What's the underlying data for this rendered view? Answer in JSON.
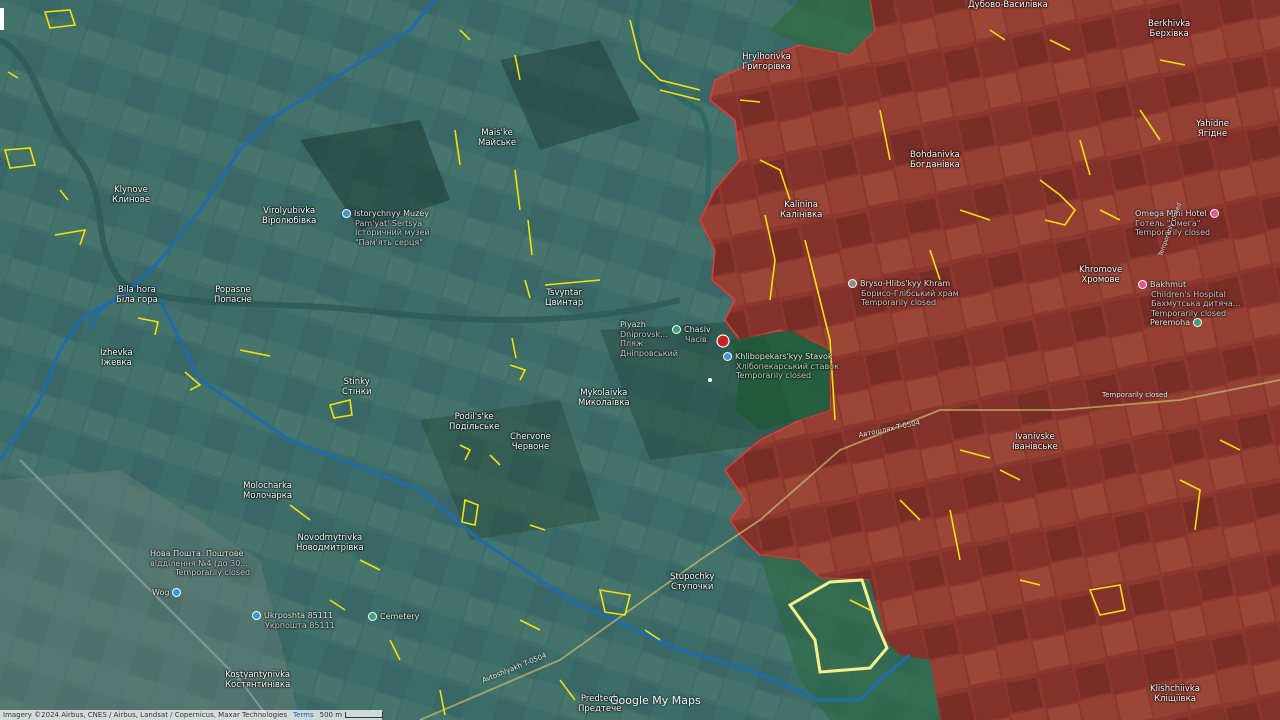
{
  "places": [
    {
      "id": "hryhorivka",
      "name": "Hrylhorivka",
      "local": "Григорівка"
    },
    {
      "id": "klynove",
      "name": "Klynove",
      "local": "Клинове"
    },
    {
      "id": "maiske",
      "name": "Mais'ke",
      "local": "Майське"
    },
    {
      "id": "virolyubivka",
      "name": "Virolyubivka",
      "local": "Віролюбівка"
    },
    {
      "id": "kalinina",
      "name": "Kalinina",
      "local": "Калінівка"
    },
    {
      "id": "bohdanivka",
      "name": "Bohdanivka",
      "local": "Богданівка"
    },
    {
      "id": "berkhivka",
      "name": "Berkhivka",
      "local": "Берхівка"
    },
    {
      "id": "yahidne",
      "name": "Yahidne",
      "local": "Ягідне"
    },
    {
      "id": "bila_hora",
      "name": "Bila hora",
      "local": "Біла гора"
    },
    {
      "id": "popasne",
      "name": "Popasne",
      "local": "Попасне"
    },
    {
      "id": "tsvyntar",
      "name": "Tsvyntar",
      "local": "Цвинтар"
    },
    {
      "id": "khromove",
      "name": "Khromove",
      "local": "Хромове"
    },
    {
      "id": "izhevka",
      "name": "Izhevka",
      "local": "Іжевка"
    },
    {
      "id": "stinky",
      "name": "Stinky",
      "local": "Стінки"
    },
    {
      "id": "mykolaivka",
      "name": "Mykolaivka",
      "local": "Миколаївка"
    },
    {
      "id": "podilske",
      "name": "Podil's'ke",
      "local": "Подільське"
    },
    {
      "id": "chervone",
      "name": "Chervone",
      "local": "Червоне"
    },
    {
      "id": "ivanivske",
      "name": "Ivanivske",
      "local": "Іванівське"
    },
    {
      "id": "molocharka",
      "name": "Molocharka",
      "local": "Молочарка"
    },
    {
      "id": "novodmytrivka",
      "name": "Novodmytrivka",
      "local": "Новодмитрівка"
    },
    {
      "id": "stupochky",
      "name": "Stupochky",
      "local": "Ступочки"
    },
    {
      "id": "kostiantynivka",
      "name": "Kostyantynivka",
      "local": "Костянтинівка"
    },
    {
      "id": "predtechyne",
      "name": "Predtech",
      "local": "Предтече"
    },
    {
      "id": "klishchiivka",
      "name": "Klishchiivka",
      "local": "Кліщіївка"
    },
    {
      "id": "dubovo",
      "name": "",
      "local": "Дубово-Василівка"
    }
  ],
  "pois": [
    {
      "id": "muzey",
      "title": "Istorychnyy Muzey",
      "sub": "Pam'yat' Sertsya",
      "sub2": "Історичний музей",
      "sub3": "\"Пам'ять серця\"",
      "color": "#3d9ad1"
    },
    {
      "id": "stavok",
      "title": "Khlibopekars'kyy Stavok",
      "sub": "Хлібопекарський ставок",
      "sub2": "Temporarily closed",
      "color": "#3d9ad1"
    },
    {
      "id": "piyazh",
      "title": "Piyazh",
      "sub": "Dniprovsk...",
      "sub2": "Пляж",
      "sub3": "Дніпровський",
      "color": "#3aa17c"
    },
    {
      "id": "chasiv",
      "title": "Chasiv",
      "sub": "Часів",
      "color": "#3aa17c"
    },
    {
      "id": "omega",
      "title": "Omega Mini Hotel",
      "sub": "Готель \"Омега\"",
      "sub2": "Temporarily closed",
      "color": "#e05a95"
    },
    {
      "id": "bakhmut_hosp",
      "title": "Bakhmut",
      "sub": "Children's Hospital",
      "sub2": "Бахмутська дитяча...",
      "sub3": "Temporarily closed",
      "color": "#e05a95"
    },
    {
      "id": "bryso",
      "title": "Bryso-Hlibs'kyy Khram",
      "sub": "Борисо-Глібський храм",
      "sub2": "Temporarily closed",
      "color": "#8c8c8c"
    },
    {
      "id": "peremoha",
      "title": "Peremoha",
      "sub": "",
      "color": "#3aa17c"
    },
    {
      "id": "novaposhta",
      "title": "Нова Пошта. Поштове",
      "sub": "відділення №4 (до 30...",
      "sub2": "Temporarily closed",
      "color": "#3d9ad1"
    },
    {
      "id": "ukrposhta",
      "title": "Ukrposhta 85111",
      "sub": "Укрпошта 85111",
      "color": "#3d9ad1"
    },
    {
      "id": "wog",
      "title": "Wog",
      "sub": "",
      "color": "#3d9ad1"
    },
    {
      "id": "cemetery",
      "title": "Cemetery",
      "sub": "",
      "color": "#3aa17c"
    }
  ],
  "roads": [
    {
      "id": "road_t0504",
      "label": "Автошлях T-0504"
    },
    {
      "id": "road_t0504b",
      "label": "Avtoshlyakh T-0504"
    },
    {
      "id": "road_temp",
      "label": "Temporarily closed"
    },
    {
      "id": "road_temp2",
      "label": "Temporarily closed"
    }
  ],
  "attribution": {
    "imagery": "Imagery ©2024 Airbus, CNES / Airbus, Landsat / Copernicus, Maxar Technologies",
    "terms": "Terms",
    "scale": "500 m"
  },
  "logo": {
    "text": "Google My Maps"
  },
  "colors": {
    "occupied": "#a8352e",
    "frontline": "#c72424",
    "contested_border": "#e03a3a",
    "fortifications": "#f2e20a",
    "defence_line": "#1f6bb0",
    "ukraine_tint": "#3f8f9a"
  }
}
